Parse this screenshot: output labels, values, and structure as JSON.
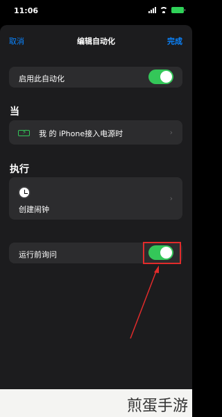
{
  "status_bar": {
    "time": "11:06"
  },
  "nav": {
    "cancel": "取消",
    "title": "编辑自动化",
    "done": "完成"
  },
  "enable_row": {
    "label": "启用此自动化",
    "on": true
  },
  "when_section": {
    "header": "当",
    "trigger_label": "我 的 iPhone接入电源时"
  },
  "do_section": {
    "header": "执行",
    "action_label": "创建闹钟"
  },
  "ask_row": {
    "label": "运行前询问",
    "on": true
  },
  "watermark": {
    "text": "煎蛋手游"
  },
  "colors": {
    "accent": "#0a84ff",
    "toggle_on": "#34c759",
    "highlight": "#e22b2b"
  },
  "icons": {
    "trigger": "battery-charging-icon",
    "action": "clock-icon",
    "chevron": "chevron-right-icon"
  }
}
